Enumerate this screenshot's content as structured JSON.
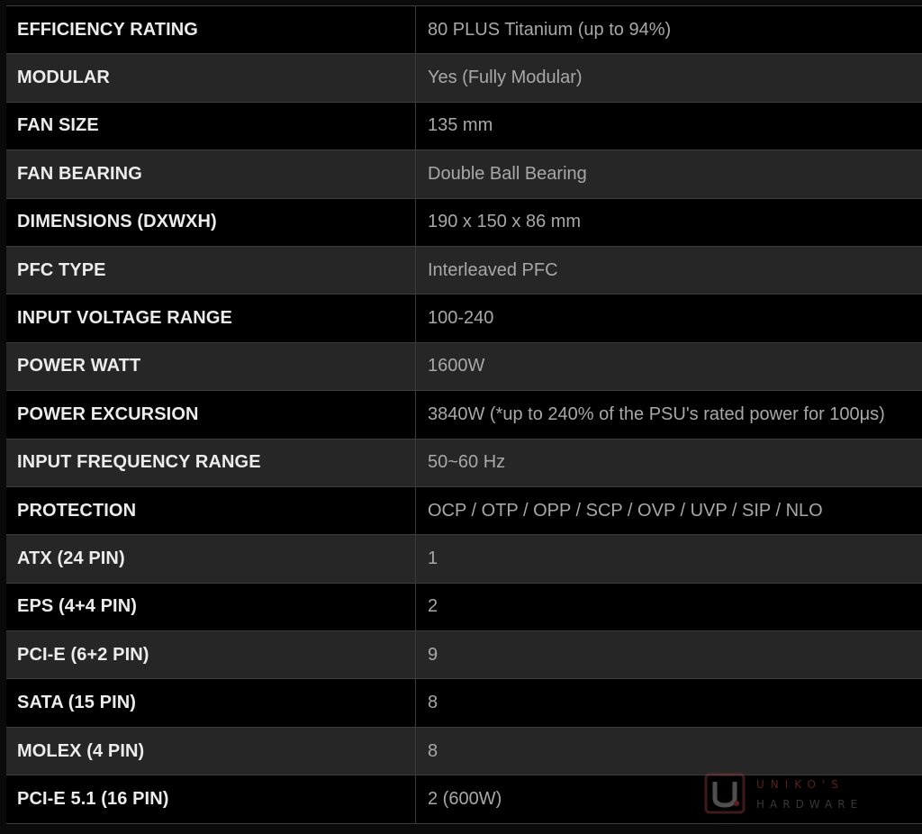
{
  "specs": [
    {
      "label": "EFFICIENCY RATING",
      "value": "80 PLUS Titanium (up to 94%)"
    },
    {
      "label": "MODULAR",
      "value": "Yes (Fully Modular)"
    },
    {
      "label": "FAN SIZE",
      "value": "135 mm"
    },
    {
      "label": "FAN BEARING",
      "value": "Double Ball Bearing"
    },
    {
      "label": "DIMENSIONS (DXWXH)",
      "value": "190 x 150 x 86 mm"
    },
    {
      "label": "PFC TYPE",
      "value": "Interleaved PFC"
    },
    {
      "label": "INPUT VOLTAGE RANGE",
      "value": "100-240"
    },
    {
      "label": "POWER WATT",
      "value": "1600W"
    },
    {
      "label": "POWER EXCURSION",
      "value": "3840W (*up to 240% of the PSU's rated power for 100μs)"
    },
    {
      "label": "INPUT FREQUENCY RANGE",
      "value": "50~60 Hz"
    },
    {
      "label": "PROTECTION",
      "value": "OCP / OTP / OPP / SCP / OVP / UVP / SIP / NLO"
    },
    {
      "label": "ATX (24 PIN)",
      "value": "1"
    },
    {
      "label": "EPS (4+4 PIN)",
      "value": "2"
    },
    {
      "label": "PCI-E (6+2 PIN)",
      "value": "9"
    },
    {
      "label": "SATA (15 PIN)",
      "value": "8"
    },
    {
      "label": "MOLEX (4 PIN)",
      "value": "8"
    },
    {
      "label": "PCI-E 5.1 (16 PIN)",
      "value": "2 (600W)"
    }
  ],
  "watermark": {
    "brand": "UNIKO'S",
    "sub": "HARDWARE",
    "icon": "uniko-logo-icon"
  },
  "colors": {
    "row_dark": "#000000",
    "row_light": "#262626",
    "label_text": "#ececec",
    "value_text": "#a8a8a8",
    "grid_line": "#3c3c3c"
  }
}
